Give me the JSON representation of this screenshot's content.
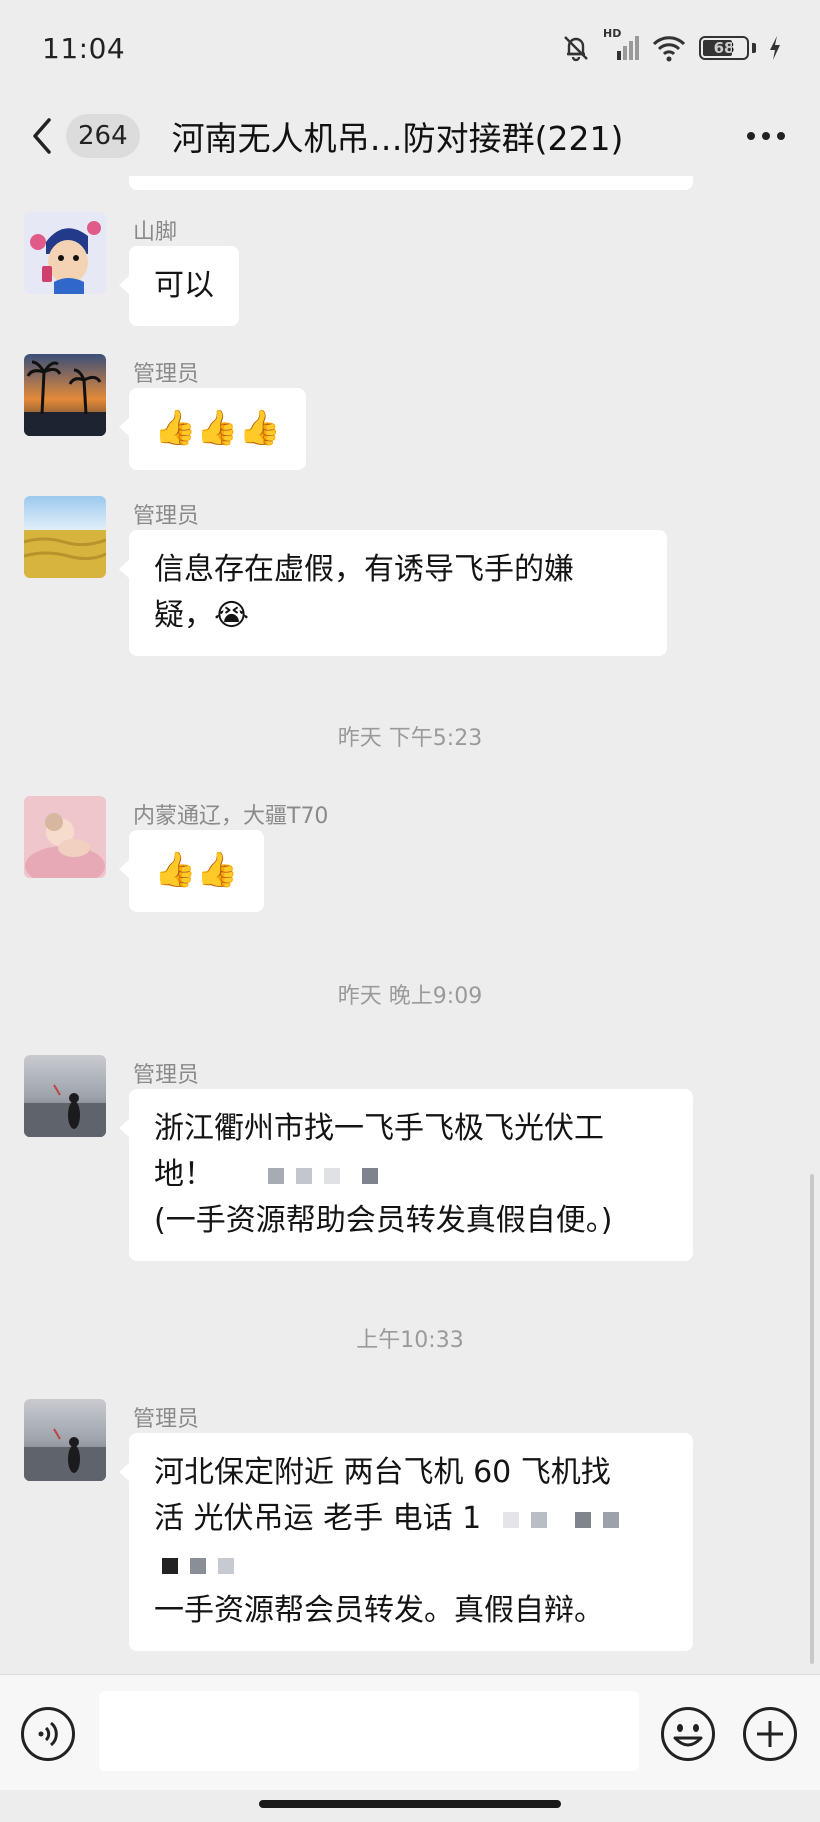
{
  "status_bar": {
    "time": "11:04",
    "battery": "68",
    "battery_level": 0.68,
    "network_label": "HD",
    "icons": [
      "mute-bell-icon",
      "signal-icon",
      "wifi-icon",
      "battery-icon",
      "charging-icon"
    ]
  },
  "header": {
    "unread_count": "264",
    "title": "河南无人机吊…防对接群(221)",
    "icons": [
      "back-chevron-icon",
      "more-dots-icon"
    ]
  },
  "messages": [
    {
      "type": "text",
      "sender": "山脚",
      "text": "可以",
      "avatar": "cartoon-avatar"
    },
    {
      "type": "emoji",
      "sender": "管理员",
      "emoji": [
        "👍",
        "👍",
        "👍"
      ],
      "avatar": "sunset-palm-avatar"
    },
    {
      "type": "text",
      "sender": "管理员",
      "lines": [
        "信息存在虚假，有诱导飞手的嫌",
        "疑，😭"
      ],
      "avatar": "wheat-field-avatar"
    },
    {
      "type": "timestamp",
      "text": "昨天 下午5:23"
    },
    {
      "type": "emoji",
      "sender": "内蒙通辽，大疆T70",
      "emoji": [
        "👍",
        "👍"
      ],
      "avatar": "pink-baby-avatar"
    },
    {
      "type": "timestamp",
      "text": "昨天 晚上9:09"
    },
    {
      "type": "text",
      "sender": "管理员",
      "lines": [
        "浙江衢州市找一飞手飞极飞光伏工",
        "地！",
        "(一手资源帮助会员转发真假自便。)"
      ],
      "avatar": "beach-silhouette-avatar"
    },
    {
      "type": "timestamp",
      "text": "上午10:33"
    },
    {
      "type": "text",
      "sender": "管理员",
      "lines": [
        "河北保定附近 两台飞机 60 飞机找",
        "活 光伏吊运 老手 电话 1",
        "",
        "一手资源帮会员转发。真假自辩。"
      ],
      "avatar": "beach-silhouette-avatar"
    }
  ],
  "input_bar": {
    "placeholder": "",
    "icons": [
      "voice-icon",
      "emoji-icon",
      "plus-icon"
    ]
  },
  "colors": {
    "background": "#ededed",
    "bubble": "#ffffff",
    "sender": "#8a8a8a",
    "timestamp": "#9a9a9a"
  }
}
